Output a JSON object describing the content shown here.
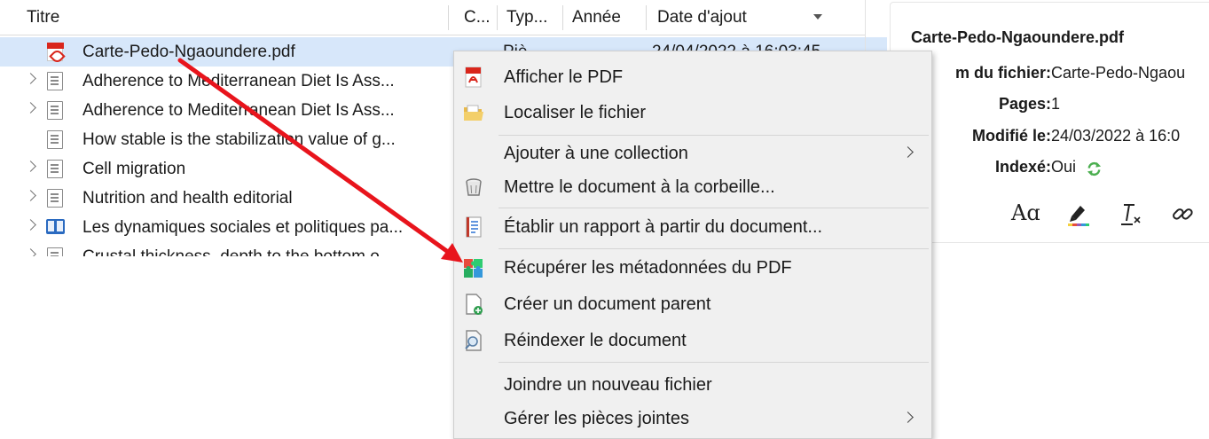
{
  "colors": {
    "selection": "#d7e7fa",
    "menu_background": "#f0f0f0",
    "annotation_arrow": "#e8141c",
    "pdf_red": "#d9261c",
    "indexed_green": "#4caf50"
  },
  "columns": {
    "title": "Titre",
    "creator": "C...",
    "type": "Typ...",
    "year": "Année",
    "date_added": "Date d'ajout"
  },
  "rows": [
    {
      "icon": "pdf-icon",
      "title": "Carte-Pedo-Ngaoundere.pdf",
      "expandable": false,
      "selected": true,
      "type": "Piè",
      "date_added": "24/04/2022 à 16:03:45"
    },
    {
      "icon": "document-icon",
      "title": "Adherence to Mediterranean Diet Is Ass...",
      "expandable": true,
      "selected": false
    },
    {
      "icon": "document-icon",
      "title": "Adherence to Mediterranean Diet Is Ass...",
      "expandable": true,
      "selected": false
    },
    {
      "icon": "document-icon",
      "title": "How stable is the stabilization value of g...",
      "expandable": false,
      "selected": false
    },
    {
      "icon": "document-icon",
      "title": "Cell migration",
      "expandable": true,
      "selected": false
    },
    {
      "icon": "document-icon",
      "title": "Nutrition and health editorial",
      "expandable": true,
      "selected": false
    },
    {
      "icon": "book-icon",
      "title": "Les dynamiques sociales et politiques pa...",
      "expandable": true,
      "selected": false
    },
    {
      "icon": "document-icon",
      "title": "Crustal thickness, depth to the bottom o...",
      "expandable": true,
      "selected": false
    }
  ],
  "context_menu": {
    "items": [
      {
        "label": "Afficher le PDF",
        "icon": "pdf-icon"
      },
      {
        "label": "Localiser le fichier",
        "icon": "folder-icon"
      },
      {
        "label": "Ajouter à une collection",
        "submenu": true
      },
      {
        "label": "Mettre le document à la corbeille...",
        "icon": "trash-icon"
      },
      {
        "label": "Établir un rapport à partir du document...",
        "icon": "report-icon"
      },
      {
        "label": "Récupérer les métadonnées du PDF",
        "icon": "puzzle-icon"
      },
      {
        "label": "Créer un document parent",
        "icon": "new-parent-icon"
      },
      {
        "label": "Réindexer le document",
        "icon": "reindex-icon"
      },
      {
        "label": "Joindre un nouveau fichier"
      },
      {
        "label": "Gérer les pièces jointes",
        "submenu": true
      }
    ]
  },
  "item_pane": {
    "title": "Carte-Pedo-Ngaoundere.pdf",
    "filename_label": "m du fichier:",
    "filename_value": "Carte-Pedo-Ngaou",
    "pages_label": "Pages:",
    "pages_value": "1",
    "modified_label": "Modifié le:",
    "modified_value": "24/03/2022 à 16:0",
    "indexed_label": "Indexé:",
    "indexed_value": "Oui",
    "note_tools": [
      "font-icon",
      "highlight-icon",
      "clear-format-icon",
      "link-icon"
    ]
  }
}
